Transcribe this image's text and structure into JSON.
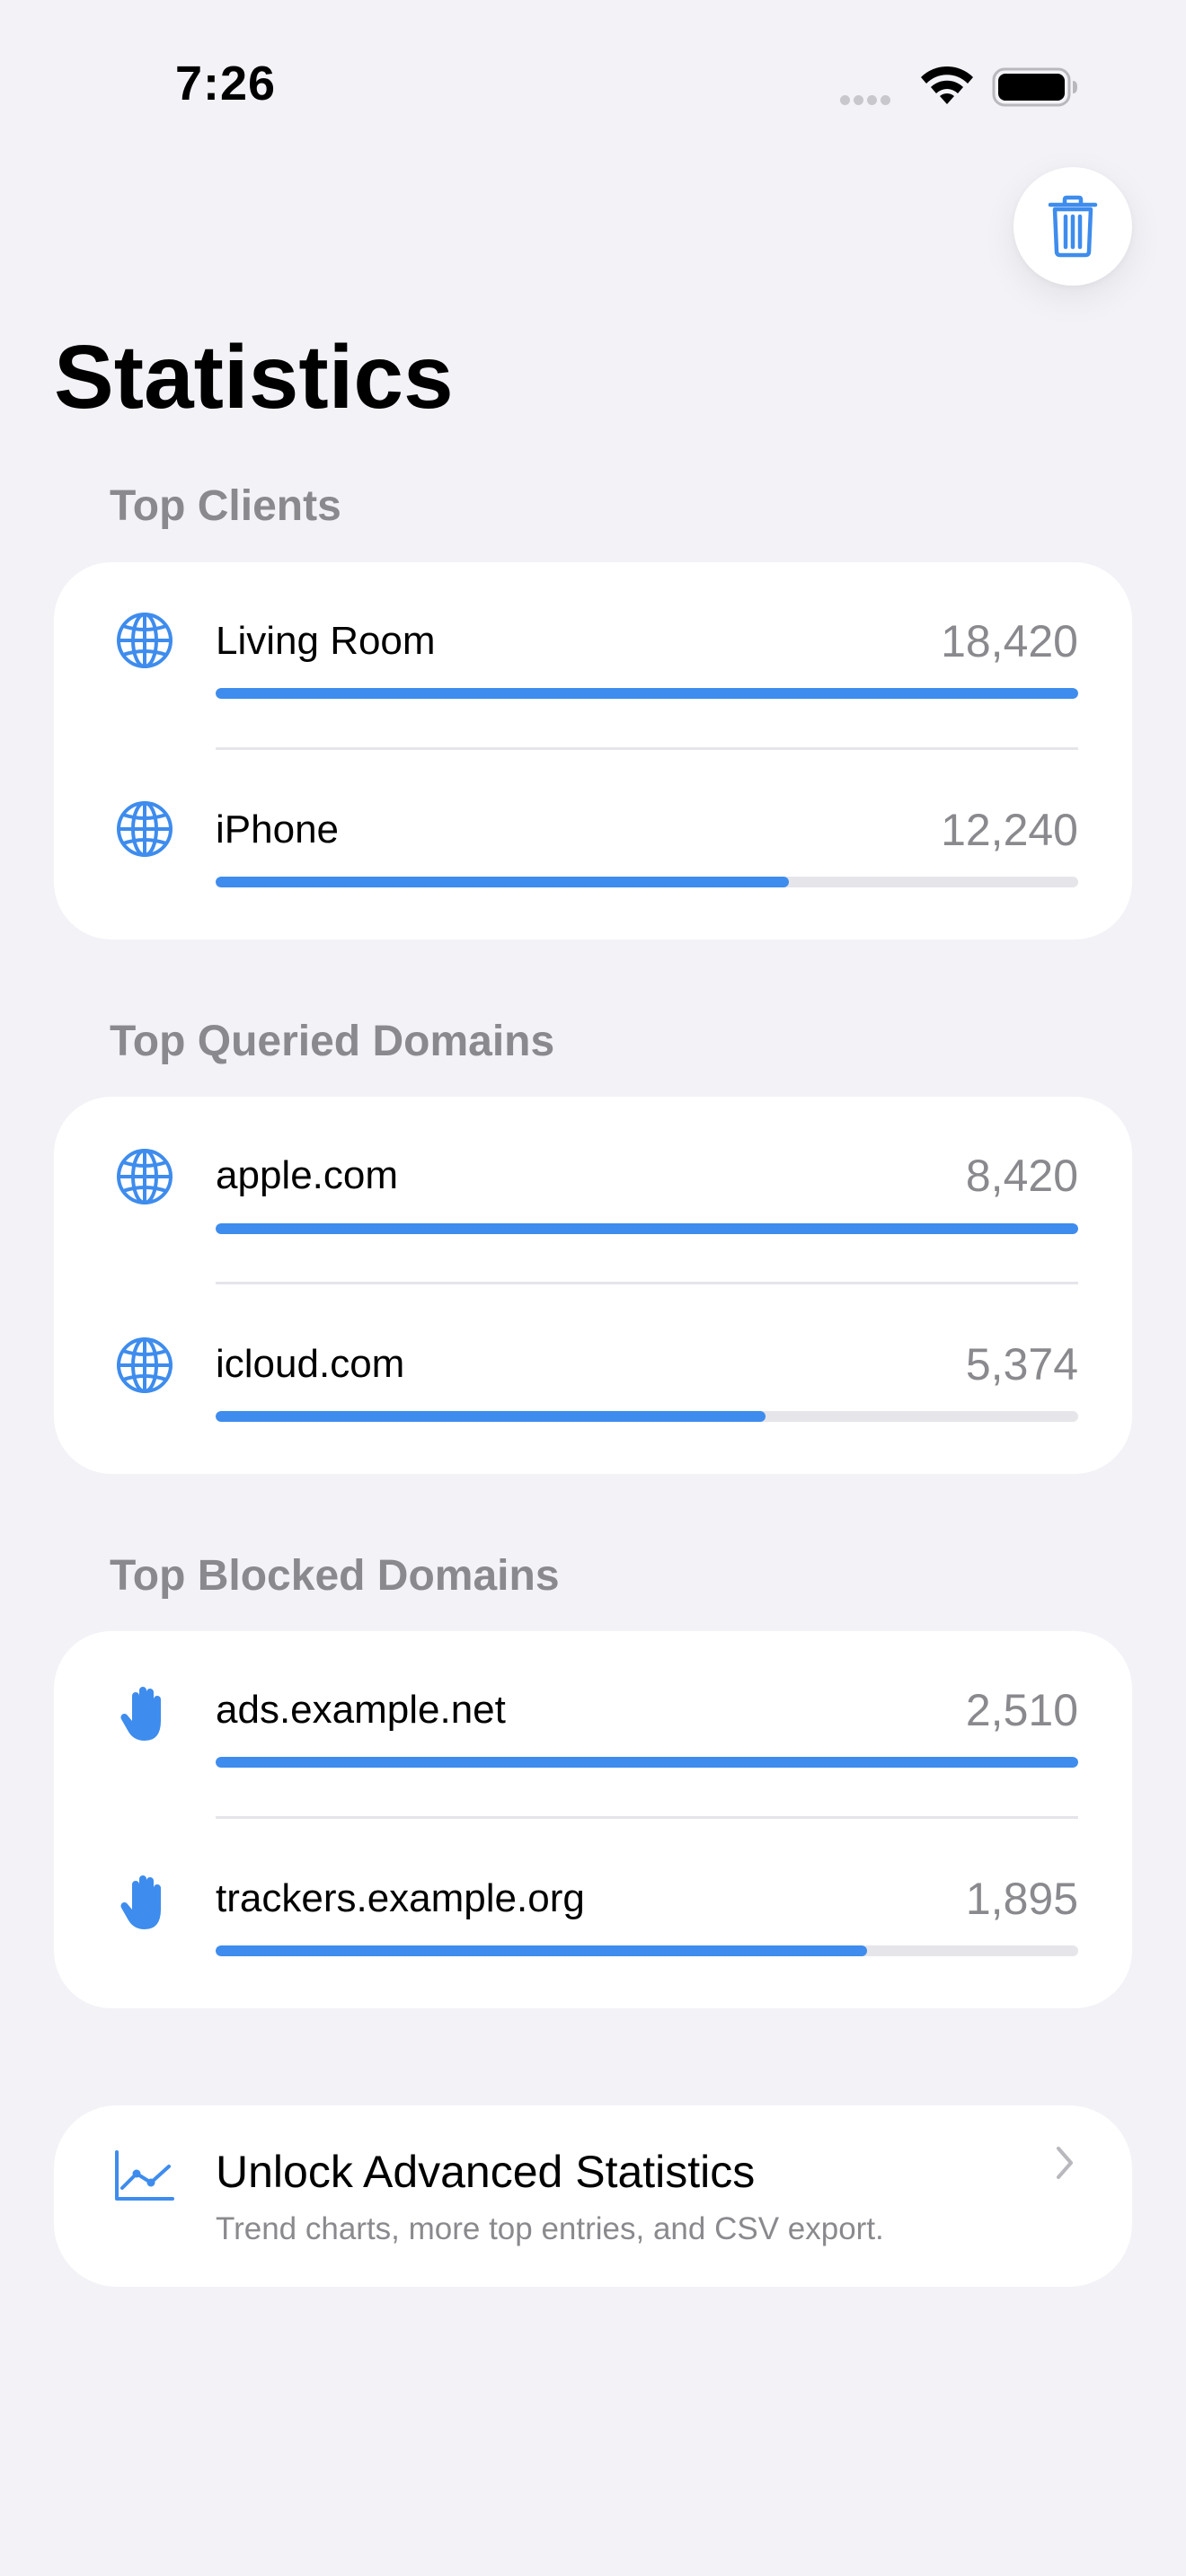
{
  "status_bar": {
    "time": "7:26"
  },
  "header": {
    "title": "Statistics",
    "trash_icon": "trash-icon"
  },
  "sections": [
    {
      "title": "Top Clients",
      "rows": [
        {
          "label": "Living Room",
          "value": "18,420",
          "fraction": 1.0,
          "icon": "globe-icon"
        },
        {
          "label": "iPhone",
          "value": "12,240",
          "fraction": 0.665,
          "icon": "globe-icon"
        }
      ]
    },
    {
      "title": "Top Queried Domains",
      "rows": [
        {
          "label": "apple.com",
          "value": "8,420",
          "fraction": 1.0,
          "icon": "globe-icon"
        },
        {
          "label": "icloud.com",
          "value": "5,374",
          "fraction": 0.638,
          "icon": "globe-icon"
        }
      ]
    },
    {
      "title": "Top Blocked Domains",
      "rows": [
        {
          "label": "ads.example.net",
          "value": "2,510",
          "fraction": 1.0,
          "icon": "hand-raised-icon"
        },
        {
          "label": "trackers.example.org",
          "value": "1,895",
          "fraction": 0.755,
          "icon": "hand-raised-icon"
        }
      ]
    }
  ],
  "upgrade": {
    "title": "Unlock Advanced Statistics",
    "subtitle": "Trend charts, more top entries, and CSV export.",
    "icon": "chart-line-icon"
  },
  "colors": {
    "accent": "#3e8ced",
    "background": "#f2f2f7",
    "card": "#ffffff",
    "secondary_text": "#8a8a8e",
    "track": "#e5e5ea"
  }
}
